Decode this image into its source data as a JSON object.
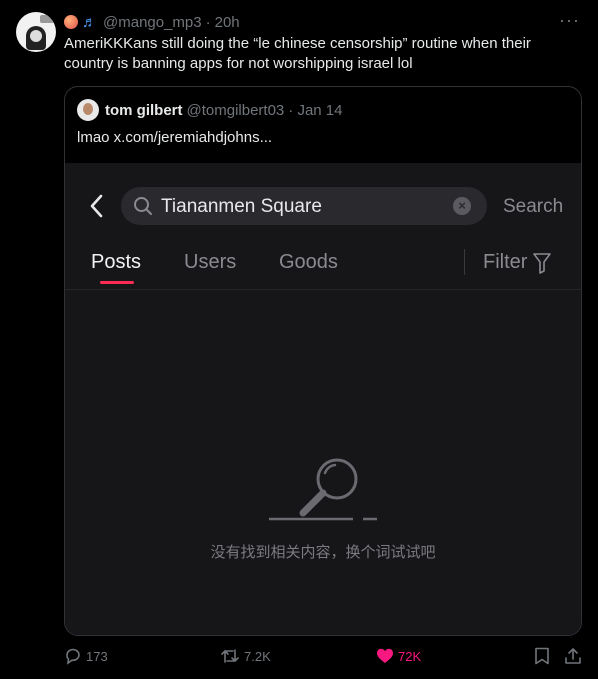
{
  "author": {
    "handle": "@mango_mp3",
    "time": "20h",
    "dot": "·",
    "emoji_name": "peach-emoji",
    "notes": "♬"
  },
  "tweet": {
    "text": "AmeriKKKans still doing the “le chinese censorship” routine when their country is banning apps for not worshipping israel lol"
  },
  "quote": {
    "name": "tom gilbert",
    "handle": "@tomgilbert03",
    "date": "· Jan 14",
    "text": "lmao  x.com/jeremiahdjohns..."
  },
  "app": {
    "search_query": "Tiananmen Square",
    "search_button": "Search",
    "clear": "×",
    "tabs": [
      "Posts",
      "Users",
      "Goods"
    ],
    "filter": "Filter",
    "empty_message": "没有找到相关内容，换个词试试吧",
    "accent": "#fe2c55"
  },
  "actions": {
    "replies": "173",
    "reposts": "7.2K",
    "likes": "72K",
    "like_color": "#f91880"
  }
}
